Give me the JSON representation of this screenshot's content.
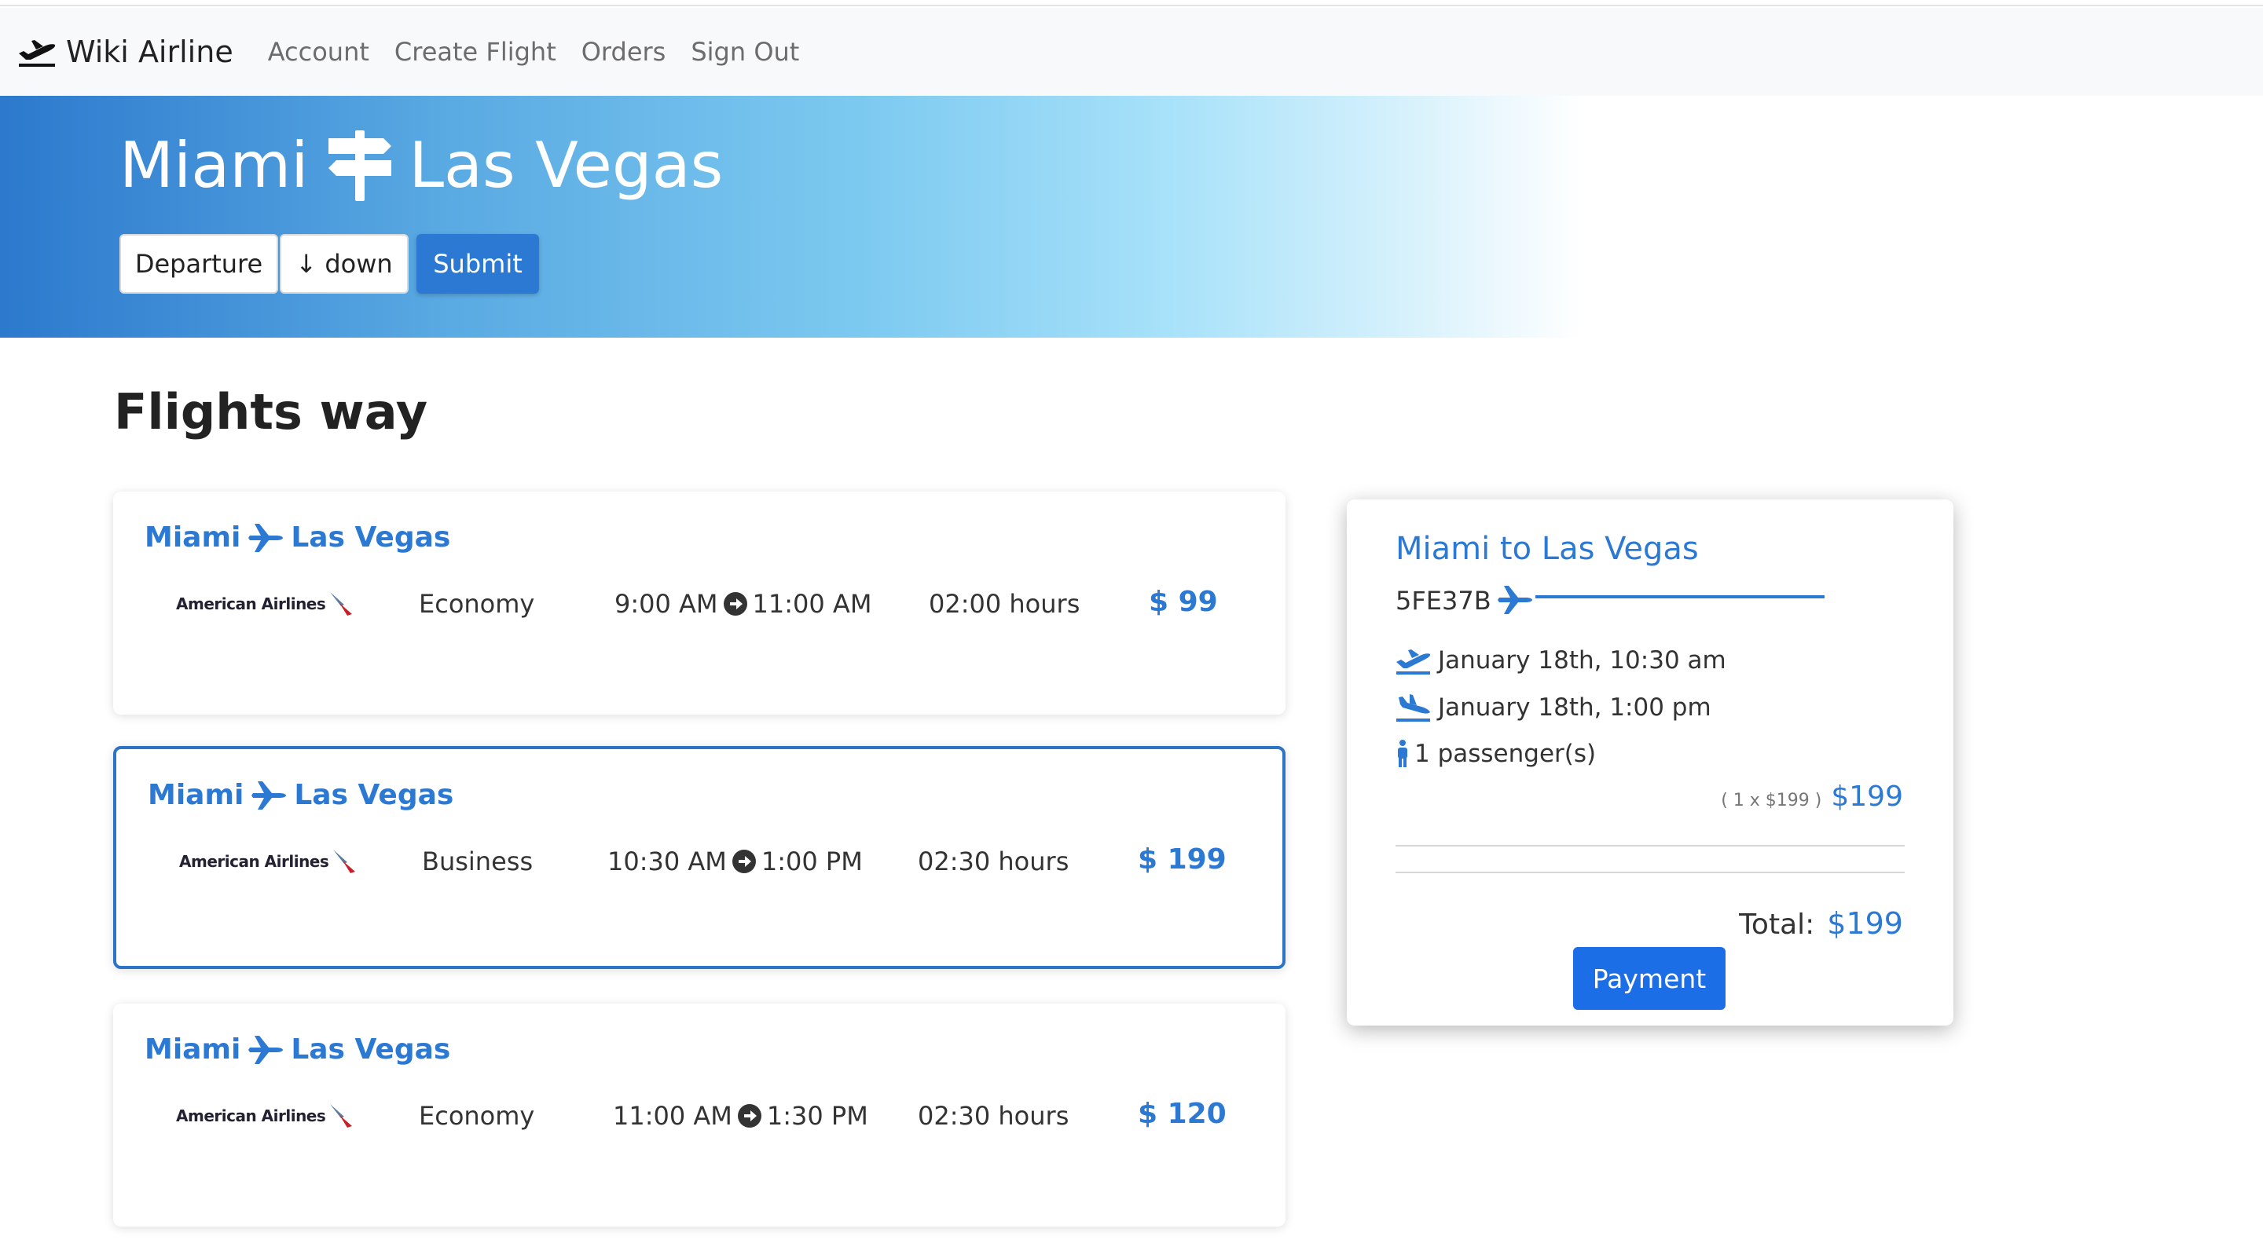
{
  "navbar": {
    "brand": "Wiki Airline",
    "links": [
      "Account",
      "Create Flight",
      "Orders",
      "Sign Out"
    ]
  },
  "hero": {
    "origin": "Miami",
    "destination": "Las Vegas",
    "sort_field": "Departure",
    "sort_direction": "↓ down",
    "submit_label": "Submit"
  },
  "section_title": "Flights way",
  "flights": [
    {
      "origin": "Miami",
      "destination": "Las Vegas",
      "airline": "American Airlines",
      "class": "Economy",
      "depart": "9:00 AM",
      "arrive": "11:00 AM",
      "duration": "02:00 hours",
      "price": "$ 99",
      "selected": false
    },
    {
      "origin": "Miami",
      "destination": "Las Vegas",
      "airline": "American Airlines",
      "class": "Business",
      "depart": "10:30 AM",
      "arrive": "1:00 PM",
      "duration": "02:30 hours",
      "price": "$ 199",
      "selected": true
    },
    {
      "origin": "Miami",
      "destination": "Las Vegas",
      "airline": "American Airlines",
      "class": "Economy",
      "depart": "11:00 AM",
      "arrive": "1:30 PM",
      "duration": "02:30 hours",
      "price": "$ 120",
      "selected": false
    }
  ],
  "summary": {
    "title": "Miami to Las Vegas",
    "code": "5FE37B",
    "departure": "January 18th, 10:30 am",
    "arrival": "January 18th, 1:00 pm",
    "passengers": "1 passenger(s)",
    "line_detail": "( 1 x $199 )",
    "line_amount": "$199",
    "total_label": "Total:",
    "total_amount": "$199",
    "payment_label": "Payment"
  },
  "colors": {
    "accent": "#2c79d4",
    "payment_button": "#1c6ee6",
    "selected_border": "#2e74c6"
  },
  "icons": {
    "brand": "plane-departure-icon",
    "hero_separator": "signpost-icon",
    "route": "plane-icon",
    "time_arrow": "arrow-circle-right-icon",
    "departure": "plane-departure-icon",
    "arrival": "plane-arrival-icon",
    "passenger": "person-icon"
  }
}
